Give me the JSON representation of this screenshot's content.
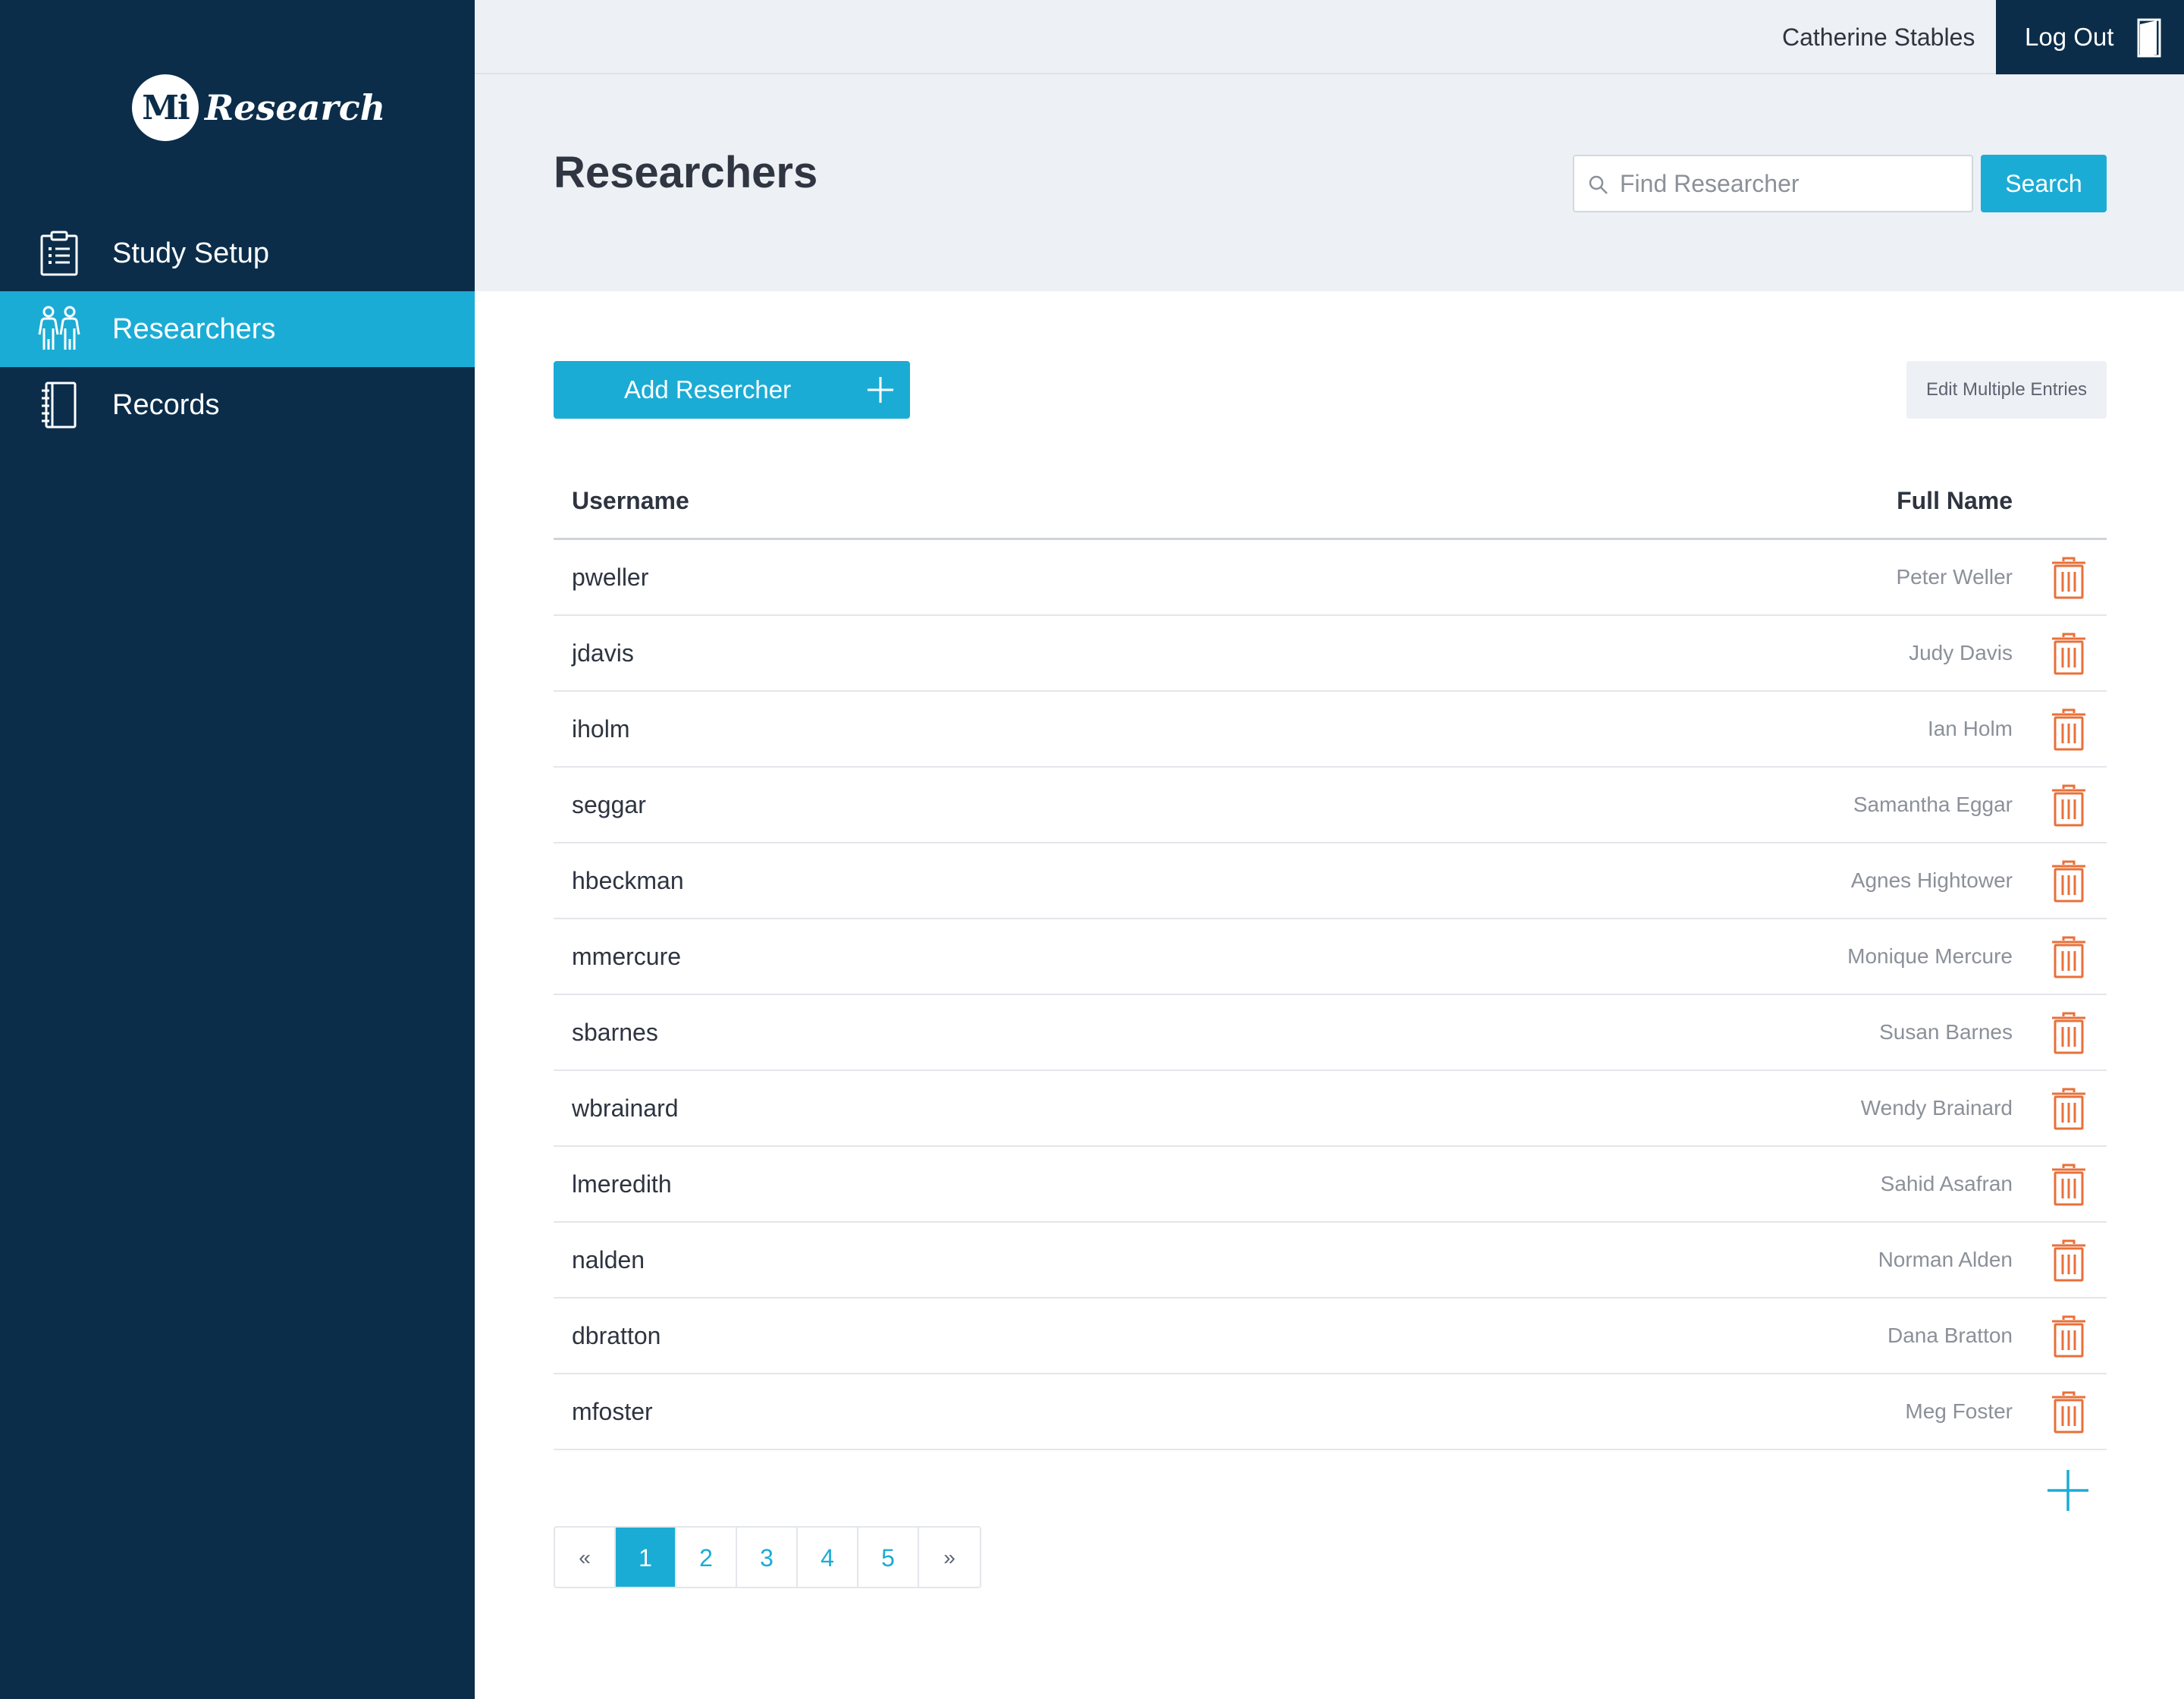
{
  "brand": {
    "badge": "Mi",
    "word": "Research"
  },
  "sidebar": {
    "items": [
      {
        "label": "Study Setup",
        "icon": "clipboard-list-icon",
        "active": false
      },
      {
        "label": "Researchers",
        "icon": "people-icon",
        "active": true
      },
      {
        "label": "Records",
        "icon": "notebook-icon",
        "active": false
      }
    ]
  },
  "topbar": {
    "user_name": "Catherine Stables",
    "logout_label": "Log Out",
    "logout_icon": "door-exit-icon"
  },
  "header": {
    "title": "Researchers",
    "search_placeholder": "Find Researcher",
    "search_icon": "search-icon",
    "search_button": "Search"
  },
  "toolbar": {
    "add_label": "Add Resercher",
    "edit_multiple_label": "Edit Multiple Entries"
  },
  "table": {
    "columns": {
      "username": "Username",
      "full_name": "Full Name"
    },
    "rows": [
      {
        "username": "pweller",
        "full_name": "Peter Weller"
      },
      {
        "username": "jdavis",
        "full_name": "Judy Davis"
      },
      {
        "username": "iholm",
        "full_name": "Ian Holm"
      },
      {
        "username": "seggar",
        "full_name": "Samantha Eggar"
      },
      {
        "username": "hbeckman",
        "full_name": "Agnes Hightower"
      },
      {
        "username": "mmercure",
        "full_name": "Monique Mercure"
      },
      {
        "username": "sbarnes",
        "full_name": "Susan Barnes"
      },
      {
        "username": "wbrainard",
        "full_name": "Wendy Brainard"
      },
      {
        "username": "lmeredith",
        "full_name": "Sahid Asafran"
      },
      {
        "username": "nalden",
        "full_name": "Norman Alden"
      },
      {
        "username": "dbratton",
        "full_name": "Dana Bratton"
      },
      {
        "username": "mfoster",
        "full_name": "Meg Foster"
      }
    ]
  },
  "pagination": {
    "prev": "«",
    "pages": [
      "1",
      "2",
      "3",
      "4",
      "5"
    ],
    "current": "1",
    "next": "»"
  },
  "colors": {
    "sidebar": "#0b2d4a",
    "accent": "#1bacd5",
    "danger": "#e8703a",
    "header_bg": "#edf0f4"
  }
}
